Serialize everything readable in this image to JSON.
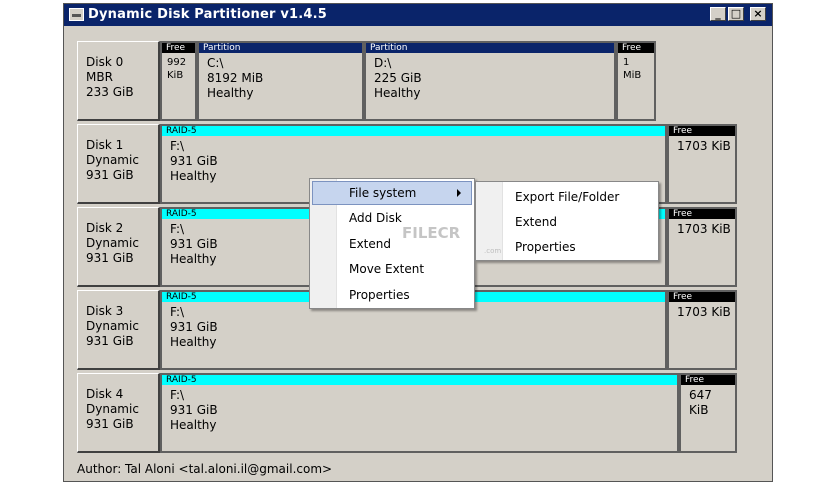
{
  "window": {
    "title": "Dynamic Disk Partitioner v1.4.5"
  },
  "disks": [
    {
      "lines": [
        "Disk 0",
        "MBR",
        "233 GiB"
      ],
      "parts": [
        {
          "header": "Free",
          "kind": "free",
          "lines": [
            "992",
            "KiB"
          ]
        },
        {
          "header": "Partition",
          "kind": "partition",
          "lines": [
            "C:\\",
            "8192 MiB",
            "Healthy"
          ]
        },
        {
          "header": "Partition",
          "kind": "partition",
          "lines": [
            "D:\\",
            "225 GiB",
            "Healthy"
          ]
        },
        {
          "header": "Free",
          "kind": "free",
          "lines": [
            "1",
            "MiB"
          ]
        }
      ]
    },
    {
      "lines": [
        "Disk 1",
        "Dynamic",
        "931 GiB"
      ],
      "parts": [
        {
          "header": "RAID-5",
          "kind": "raid",
          "lines": [
            "F:\\",
            "931 GiB",
            "Healthy"
          ]
        },
        {
          "header": "Free",
          "kind": "free",
          "lines": [
            "1703 KiB"
          ]
        }
      ]
    },
    {
      "lines": [
        "Disk 2",
        "Dynamic",
        "931 GiB"
      ],
      "parts": [
        {
          "header": "RAID-5",
          "kind": "raid",
          "lines": [
            "F:\\",
            "931 GiB",
            "Healthy"
          ]
        },
        {
          "header": "Free",
          "kind": "free",
          "lines": [
            "1703 KiB"
          ]
        }
      ]
    },
    {
      "lines": [
        "Disk 3",
        "Dynamic",
        "931 GiB"
      ],
      "parts": [
        {
          "header": "RAID-5",
          "kind": "raid",
          "lines": [
            "F:\\",
            "931 GiB",
            "Healthy"
          ]
        },
        {
          "header": "Free",
          "kind": "free",
          "lines": [
            "1703 KiB"
          ]
        }
      ]
    },
    {
      "lines": [
        "Disk 4",
        "Dynamic",
        "931 GiB"
      ],
      "parts": [
        {
          "header": "RAID-5",
          "kind": "raid",
          "lines": [
            "F:\\",
            "931 GiB",
            "Healthy"
          ]
        },
        {
          "header": "Free",
          "kind": "free",
          "lines": [
            "647",
            "KiB"
          ]
        }
      ]
    }
  ],
  "context_menu": {
    "items": [
      "File system",
      "Add Disk",
      "Extend",
      "Move Extent",
      "Properties"
    ],
    "submenu": [
      "Export File/Folder",
      "Extend",
      "Properties"
    ]
  },
  "author": "Author: Tal Aloni <tal.aloni.il@gmail.com>",
  "watermark": {
    "text": "FILECR",
    "sub": ".com"
  },
  "colors": {
    "titlebar": "#0a246a",
    "raid_header": "#00ffff",
    "free_header": "#000000",
    "window_bg": "#d4d0c8",
    "menu_highlight": "#c6d5ee"
  }
}
